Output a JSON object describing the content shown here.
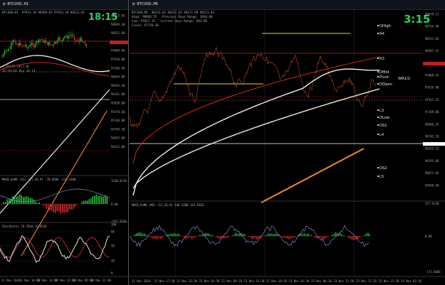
{
  "left_chart": {
    "window_title": "BTCUSD,H1",
    "header_text": "BTCUSD,H1  97933.10 98268.81 97933.10 98221.81",
    "timer": "18:15",
    "price_ticks": [
      "99015.65",
      "98894.30",
      "98552.60",
      "98211.00",
      "97869.60",
      "97528.00",
      "97186.40",
      "96844.80",
      "96503.20",
      "96161.60",
      "95820.00",
      "95478.40",
      "95136.80",
      "94795.20",
      "94453.60",
      "94112.00"
    ],
    "info_lines": [
      "1:BB+H1 OP|1:BL",
      "D1:H1/H1 Buy 10.14"
    ],
    "macd_label": "MACD_OsMA (41) (12,26,9) -70.0504 -131.4440",
    "macd_ticks": [
      "1230.8139",
      "0.00",
      "-925.5638"
    ],
    "stoch_label": "Stochastic 74.7018 12.8236",
    "stoch_ticks": [
      "100",
      "80",
      "50",
      "20",
      "0"
    ],
    "time_labels": [
      "21 Nov 2024",
      "21 Nov 10:00",
      "22 Nov 13:00",
      "22 Nov 22:00",
      "23 Nov 05:00",
      "23 Nov 21:00"
    ]
  },
  "right_chart": {
    "window_title": "BTCUSD,M5",
    "header_text": "BTCUSD,M5  98223.83 98222.83 98171.89 98221.83",
    "timer": "3:15",
    "info_lines": [
      "High: 98966.55   Previous Days Range: 3930.80",
      "Low: 97027.15   Current Days Range: 943.96",
      "Close: 97726.36"
    ],
    "price_ticks": [
      "98978.11",
      "98754.58",
      "98531.03",
      "98307.47",
      "98084.00",
      "97860.45",
      "97636.90",
      "97413.35",
      "97189.80",
      "96966.25",
      "96742.70",
      "96519.15",
      "96295.60",
      "96072.05",
      "95848.50"
    ],
    "level_labels": {
      "dhigh": "DHigh",
      "r4": "R4",
      "r3": "R3",
      "mid": "DMid",
      "pivot": "Pivot",
      "wr": "WR1/2",
      "open": "DOpen",
      "l3": "L3",
      "low": "DLow",
      "s1": "DS1",
      "l4": "L4",
      "s2": "DS2",
      "l5": "L5"
    },
    "macd_label": "MACD_OsMA (M5) (12,26,9) 146.5200 143.0562",
    "macd_ticks": [
      "227.6130",
      "0.00",
      "-171.6686"
    ],
    "time_labels": [
      "21 Nov 2024",
      "21 Nov 17:50",
      "21 Nov 22:30",
      "22 Nov 03:50",
      "22 Nov 09:10",
      "22 Nov 14:30",
      "22 Nov 19:50",
      "23 Nov 01:10",
      "23 Nov 06:30",
      "23 Nov 11:50",
      "23 Nov 17:10",
      "23 Nov 22:30",
      "24 Nov 03:50"
    ]
  },
  "colors": {
    "candle_up": "#2fd13a",
    "candle_down": "#d23c2f",
    "ma_white": "#ffffff",
    "ma_red": "#d7281e",
    "ma_orange": "#f08a2a",
    "price_line": "#b44a28",
    "yellow_level": "#e6d23c",
    "hist_up": "#22c43a",
    "hist_down": "#d32a2a",
    "signal_line": "#7f86c8",
    "timer": "#27d35f"
  }
}
